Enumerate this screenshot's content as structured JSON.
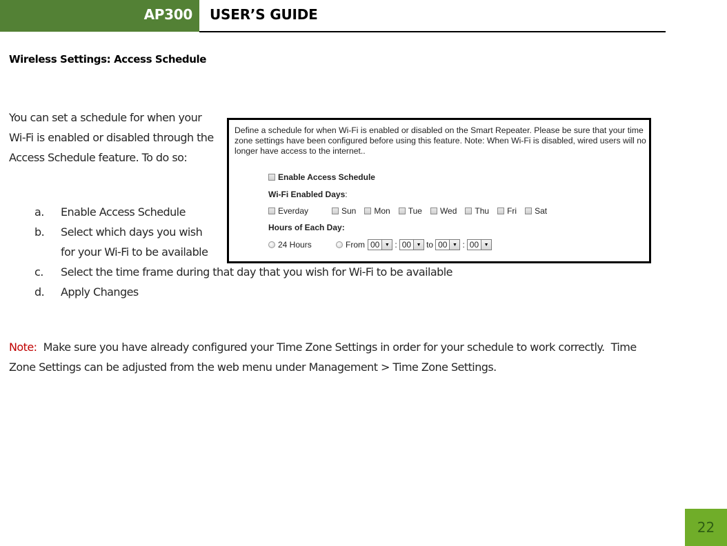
{
  "header": {
    "product": "AP300",
    "title": "USER’S GUIDE"
  },
  "section_title": "Wireless Settings: Access Schedule",
  "intro": "You can set a schedule for when your Wi-Fi is enabled or disabled through the Access Schedule feature.  To do so:",
  "steps": [
    {
      "marker": "a.",
      "text": "Enable Access Schedule"
    },
    {
      "marker": "b.",
      "text": "Select which days you wish for your Wi-Fi to be available"
    },
    {
      "marker": "c.",
      "text": "Select the time frame during that day that you wish for Wi-Fi to be available"
    },
    {
      "marker": "d.",
      "text": "Apply Changes"
    }
  ],
  "note": {
    "label": "Note:",
    "text": "  Make sure you have already configured your Time Zone Settings in order for your schedule to work correctly.  Time Zone Settings can be adjusted from the web menu under Management > Time Zone Settings."
  },
  "screenshot": {
    "description": "Define a schedule for when Wi-Fi is enabled or disabled on the Smart Repeater. Please be sure that your time zone settings have been configured before using this feature. Note: When Wi-Fi is disabled, wired users will no longer have access to the internet..",
    "enable_label": "Enable Access Schedule",
    "enable_checked": false,
    "days_label": "Wi-Fi Enabled Days",
    "days_colon": ":",
    "days": [
      {
        "label": "Everday",
        "checked": false
      },
      {
        "label": "Sun",
        "checked": false
      },
      {
        "label": "Mon",
        "checked": false
      },
      {
        "label": "Tue",
        "checked": false
      },
      {
        "label": "Wed",
        "checked": false
      },
      {
        "label": "Thu",
        "checked": false
      },
      {
        "label": "Fri",
        "checked": false
      },
      {
        "label": "Sat",
        "checked": false
      }
    ],
    "hours_label": "Hours of Each Day:",
    "option_24h": "24 Hours",
    "option_from": "From",
    "from_hour": "00",
    "from_minute": "00",
    "to_label": "to",
    "to_hour": "00",
    "to_minute": "00",
    "time_sep": ":",
    "arrow_icon": "▼"
  },
  "page_number": "22",
  "colors": {
    "header_green": "#538135",
    "page_badge_green": "#70ad29",
    "note_red": "#c00000"
  }
}
